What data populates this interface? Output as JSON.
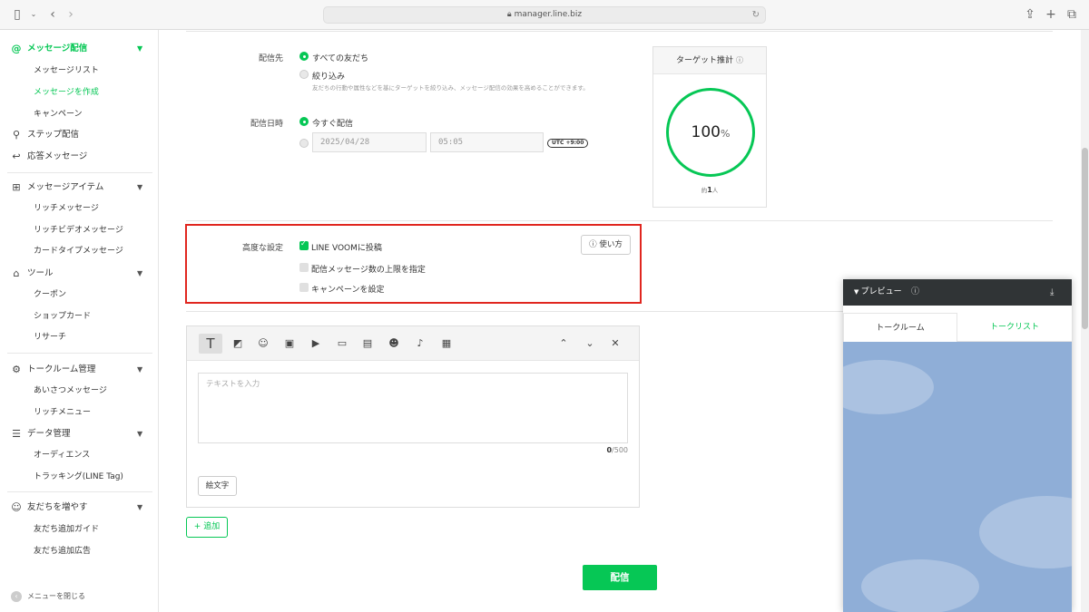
{
  "browser": {
    "url": "manager.line.biz"
  },
  "sidebar": {
    "groups": [
      {
        "label": "メッセージ配信",
        "icon": "at-icon",
        "subs": [
          "メッセージリスト",
          "メッセージを作成",
          "キャンペーン"
        ]
      },
      {
        "label": "ステップ配信",
        "icon": "hierarchy-icon"
      },
      {
        "label": "応答メッセージ",
        "icon": "reply-icon"
      },
      {
        "label": "メッセージアイテム",
        "icon": "plus-box-icon",
        "subs": [
          "リッチメッセージ",
          "リッチビデオメッセージ",
          "カードタイプメッセージ"
        ]
      },
      {
        "label": "ツール",
        "icon": "store-icon",
        "subs": [
          "クーポン",
          "ショップカード",
          "リサーチ"
        ]
      },
      {
        "label": "トークルーム管理",
        "icon": "chat-settings-icon",
        "subs": [
          "あいさつメッセージ",
          "リッチメニュー"
        ]
      },
      {
        "label": "データ管理",
        "icon": "database-icon",
        "subs": [
          "オーディエンス",
          "トラッキング(LINE Tag)"
        ]
      },
      {
        "label": "友だちを増やす",
        "icon": "add-friend-icon",
        "subs": [
          "友だち追加ガイド",
          "友だち追加広告"
        ]
      }
    ],
    "close_menu": "メニューを閉じる"
  },
  "form": {
    "recipients": {
      "label": "配信先",
      "option_all": "すべての友だち",
      "option_filter": "絞り込み",
      "filter_hint": "友だちの行動や属性などを基にターゲットを絞り込み、メッセージ配信の効果を高めることができます。"
    },
    "schedule": {
      "label": "配信日時",
      "option_now": "今すぐ配信",
      "date": "2025/04/28",
      "time": "05:05",
      "timezone": "UTC +9:00"
    },
    "target": {
      "title": "ターゲット推計",
      "percent": "100",
      "percent_unit": "%",
      "approx_prefix": "約",
      "approx_count": "1",
      "approx_suffix": "人"
    },
    "advanced": {
      "label": "高度な設定",
      "option_voom": "LINE VOOMに投稿",
      "option_limit": "配信メッセージ数の上限を指定",
      "option_campaign": "キャンペーンを設定",
      "howto": "使い方"
    }
  },
  "editor": {
    "placeholder": "テキストを入力",
    "count": "0",
    "max": "/500",
    "emoji_button": "絵文字"
  },
  "actions": {
    "add": "追加",
    "send": "配信"
  },
  "preview": {
    "title": "プレビュー",
    "tab_talkroom": "トークルーム",
    "tab_talklist": "トークリスト"
  },
  "colors": {
    "accent": "#06c755",
    "highlight": "#e0261f",
    "preview_bg": "#8faed7"
  }
}
